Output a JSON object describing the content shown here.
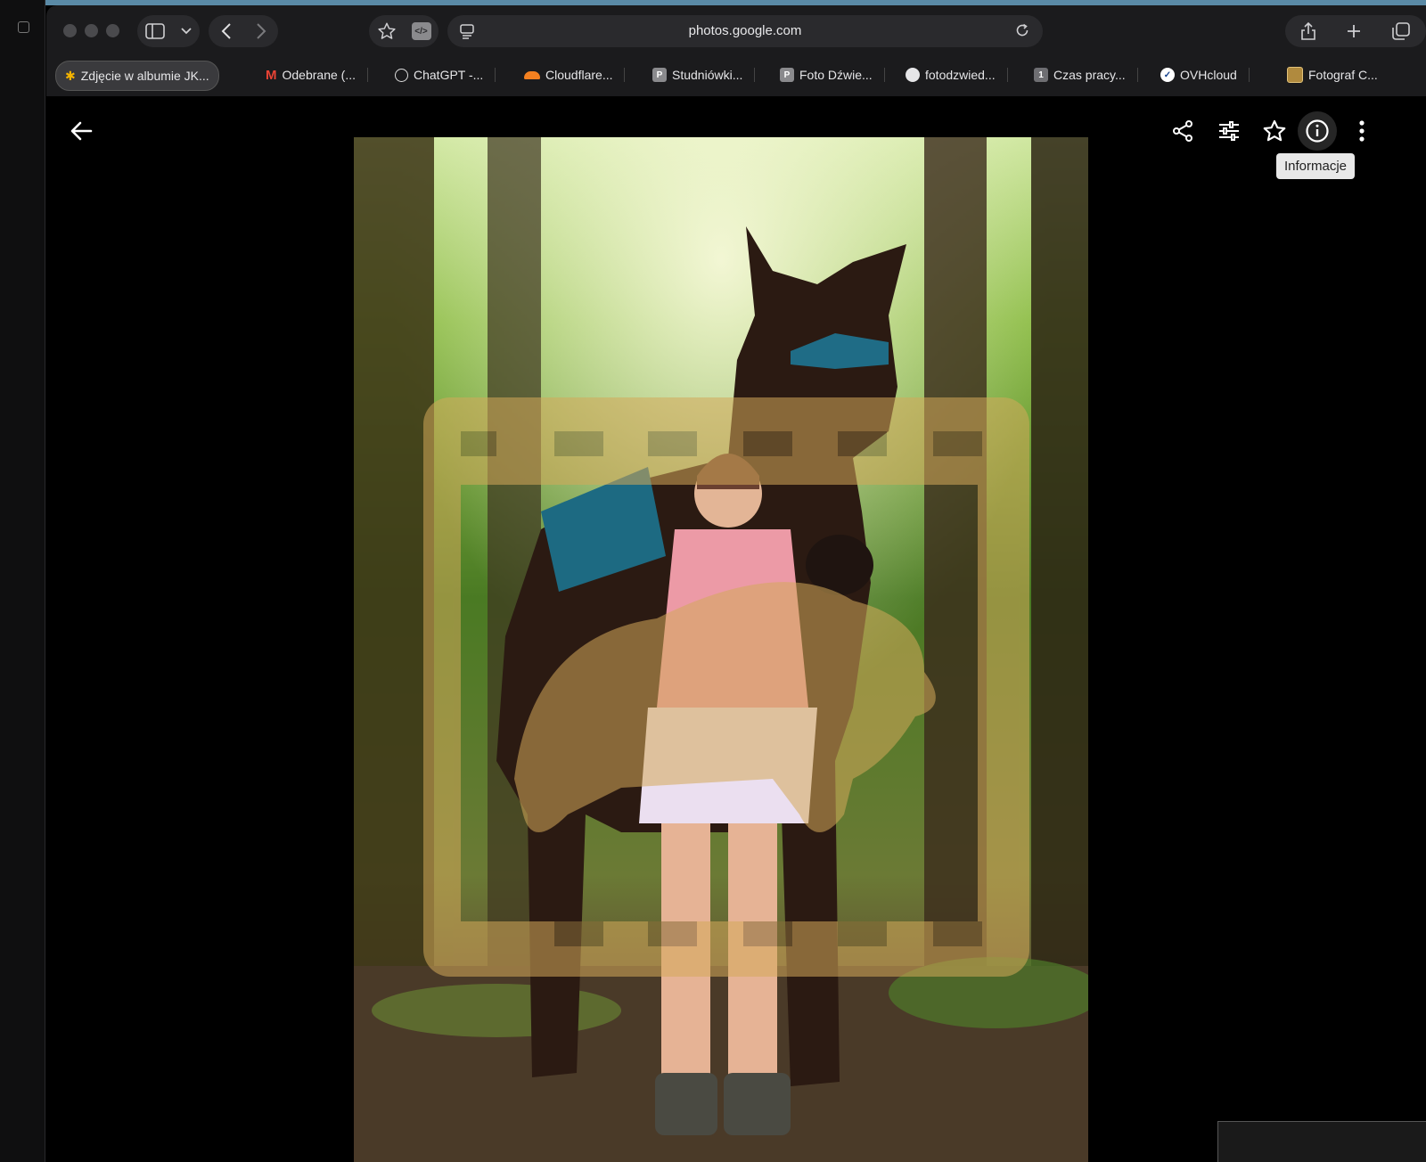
{
  "browser": {
    "url": "photos.google.com",
    "bookmarks": [
      {
        "label": "Zdjęcie w albumie JK...",
        "icon": "google-photos-icon",
        "active": true
      },
      {
        "label": "Odebrane (...",
        "icon": "gmail-icon"
      },
      {
        "label": "ChatGPT -...",
        "icon": "chatgpt-icon"
      },
      {
        "label": "Cloudflare...",
        "icon": "cloudflare-icon"
      },
      {
        "label": "Studniówki...",
        "icon": "p-icon"
      },
      {
        "label": "Foto Dźwie...",
        "icon": "p-icon"
      },
      {
        "label": "fotodzwied...",
        "icon": "github-icon"
      },
      {
        "label": "Czas pracy...",
        "icon": "number-one-icon"
      },
      {
        "label": "OVHcloud",
        "icon": "ovhcloud-icon"
      },
      {
        "label": "Fotograf C...",
        "icon": "photo-frame-icon"
      }
    ]
  },
  "viewer": {
    "tooltip": "Informacje",
    "tools": [
      "share-icon",
      "edit-sliders-icon",
      "star-icon",
      "info-icon",
      "more-vertical-icon"
    ]
  },
  "colors": {
    "toolbar_bg": "#1b1b1d",
    "accent": "#5a8aa6",
    "overlay_gold": "#d4a95a"
  }
}
